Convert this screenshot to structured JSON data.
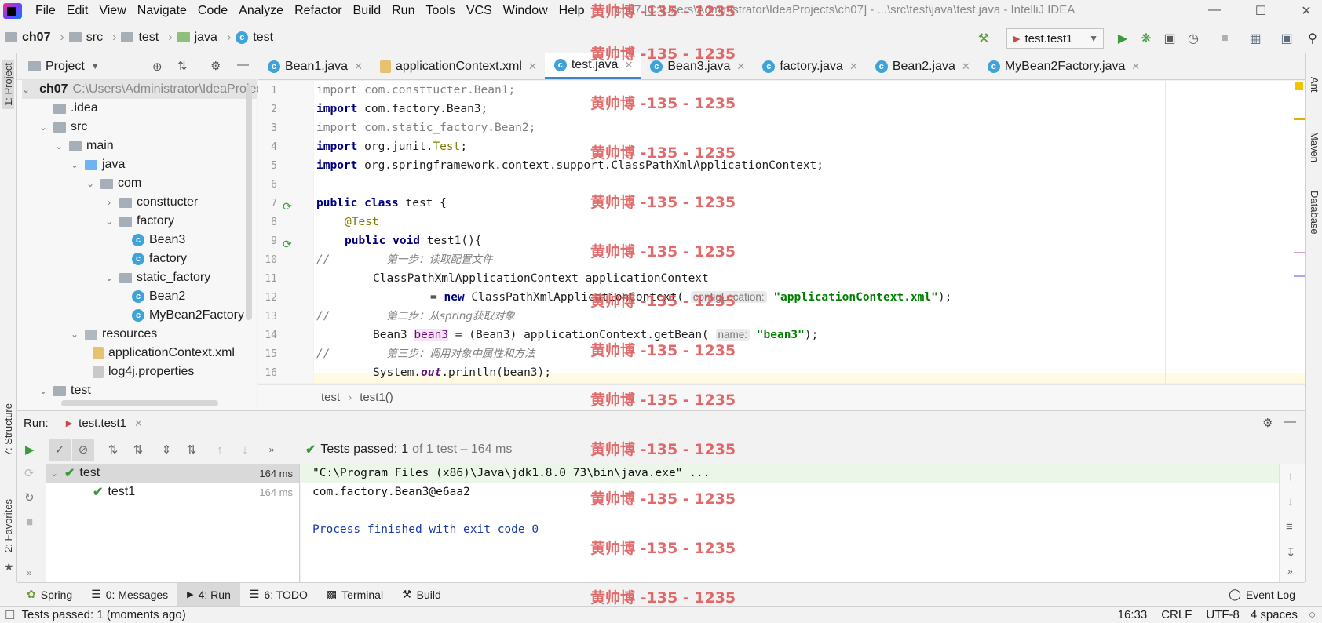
{
  "app": {
    "window_title": "ch07 [C:\\Users\\Administrator\\IdeaProjects\\ch07] - ...\\src\\test\\java\\test.java - IntelliJ IDEA",
    "menu": [
      "File",
      "Edit",
      "View",
      "Navigate",
      "Code",
      "Analyze",
      "Refactor",
      "Build",
      "Run",
      "Tools",
      "VCS",
      "Window",
      "Help"
    ]
  },
  "breadcrumb": [
    "ch07",
    "src",
    "test",
    "java",
    "test"
  ],
  "run_config": "test.test1",
  "project_panel": {
    "title": "Project",
    "tree": [
      {
        "label": "ch07",
        "detail": "C:\\Users\\Administrator\\IdeaProjec"
      },
      {
        "label": ".idea"
      },
      {
        "label": "src"
      },
      {
        "label": "main"
      },
      {
        "label": "java"
      },
      {
        "label": "com"
      },
      {
        "label": "consttucter"
      },
      {
        "label": "factory"
      },
      {
        "label": "Bean3"
      },
      {
        "label": "factory"
      },
      {
        "label": "static_factory"
      },
      {
        "label": "Bean2"
      },
      {
        "label": "MyBean2Factory"
      },
      {
        "label": "resources"
      },
      {
        "label": "applicationContext.xml"
      },
      {
        "label": "log4j.properties"
      },
      {
        "label": "test"
      }
    ]
  },
  "editor_tabs": [
    "Bean1.java",
    "applicationContext.xml",
    "test.java",
    "Bean3.java",
    "factory.java",
    "Bean2.java",
    "MyBean2Factory.java"
  ],
  "active_tab": "test.java",
  "code": {
    "line_numbers": [
      "1",
      "2",
      "3",
      "4",
      "5",
      "6",
      "7",
      "8",
      "9",
      "10",
      "11",
      "12",
      "13",
      "14",
      "15",
      "16"
    ],
    "l1_kw": "import",
    "l1_rest": " com.consttucter.Bean1;",
    "l2_kw": "import",
    "l2_rest": " com.factory.Bean3;",
    "l3_kw": "import",
    "l3_rest": " com.static_factory.Bean2;",
    "l4_kw": "import",
    "l4_a": " org.junit.",
    "l4_b": "Test",
    "l4_c": ";",
    "l5_kw": "import",
    "l5_rest": " org.springframework.context.support.ClassPathXmlApplicationContext;",
    "l7_kw": "public class",
    "l7_rest": " test {",
    "l8": "@Test",
    "l9_kw": "public void",
    "l9_rest": " test1(){",
    "l10_a": "//",
    "l10_b": "第一步：读取配置文件",
    "l11": "ClassPathXmlApplicationContext applicationContext",
    "l12_a": "= ",
    "l12_kw": "new",
    "l12_b": " ClassPathXmlApplicationContext(",
    "l12_hint": "configLocation:",
    "l12_str": "\"applicationContext.xml\"",
    "l12_c": ");",
    "l13_a": "//",
    "l13_b": "第二步：从spring获取对象",
    "l14_a": "Bean3 ",
    "l14_b": "bean3",
    "l14_c": " = (Bean3) applicationContext.getBean(",
    "l14_hint": "name:",
    "l14_str": "\"bean3\"",
    "l14_d": ");",
    "l15_a": "//",
    "l15_b": "第三步：调用对象中属性和方法",
    "l16_a": "System.",
    "l16_b": "out",
    "l16_c": ".println(bean3);"
  },
  "editor_breadcrumb": [
    "test",
    "test1()"
  ],
  "run_panel": {
    "label": "Run:",
    "tab": "test.test1",
    "status_prefix": "Tests passed:",
    "status_count": "1",
    "status_suffix": "of 1 test – 164 ms",
    "tree": [
      {
        "label": "test",
        "time": "164 ms"
      },
      {
        "label": "test1",
        "time": "164 ms"
      }
    ],
    "console": [
      "\"C:\\Program Files (x86)\\Java\\jdk1.8.0_73\\bin\\java.exe\" ...",
      "com.factory.Bean3@e6aa2",
      "Process finished with exit code 0"
    ]
  },
  "side_tabs_left": [
    "1: Project",
    "7: Structure",
    "2: Favorites"
  ],
  "side_tabs_right": [
    "Ant",
    "Maven",
    "Database"
  ],
  "bottom_tabs": [
    "Spring",
    "0: Messages",
    "4: Run",
    "6: TODO",
    "Terminal",
    "Build"
  ],
  "event_log": "Event Log",
  "statusbar": {
    "message": "Tests passed: 1 (moments ago)",
    "position": "16:33",
    "line_sep": "CRLF",
    "encoding": "UTF-8",
    "indent": "4 spaces"
  },
  "watermark": "黄帅博 -135 - 1235",
  "colors": {
    "accent": "#4083c9",
    "pass": "#3c9a3c",
    "keyword": "#000080",
    "string": "#008000",
    "watermark": "#e05a5a"
  }
}
